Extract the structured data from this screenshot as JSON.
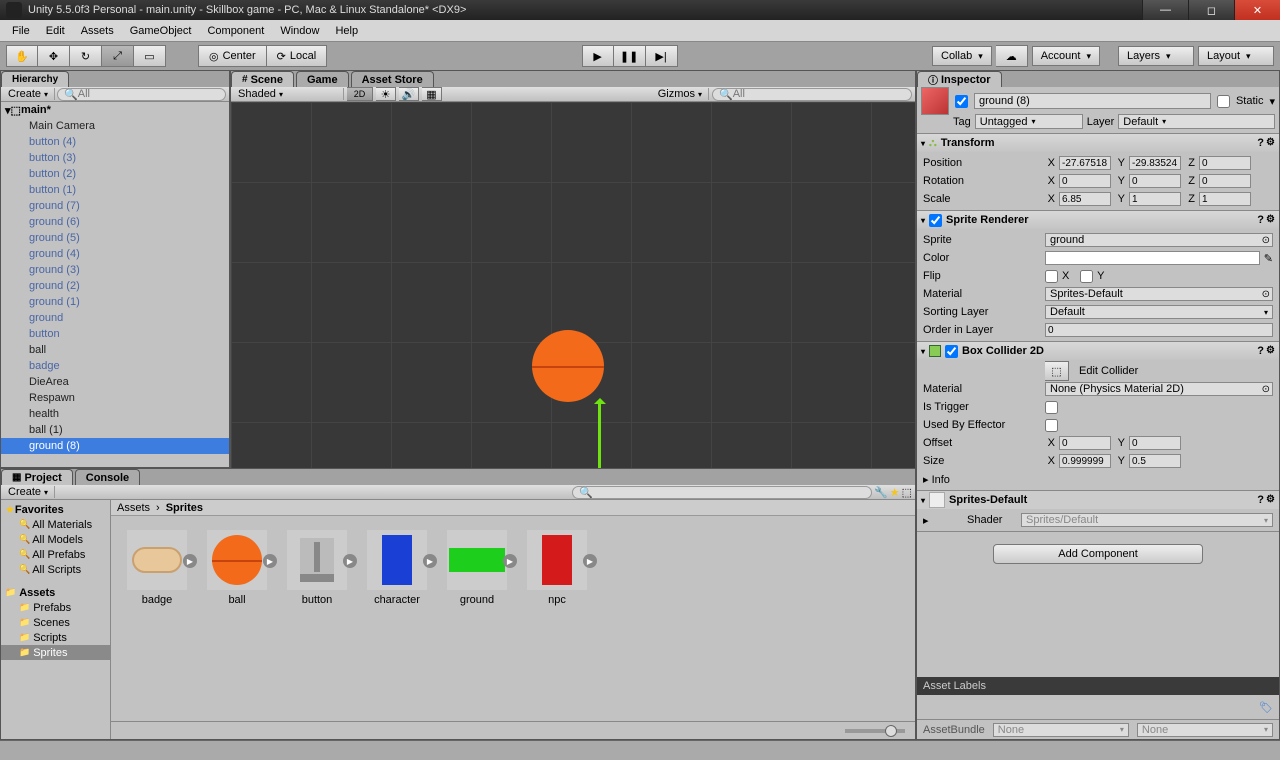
{
  "window": {
    "title": "Unity 5.5.0f3 Personal - main.unity - Skillbox game - PC, Mac & Linux Standalone* <DX9>"
  },
  "menu": [
    "File",
    "Edit",
    "Assets",
    "GameObject",
    "Component",
    "Window",
    "Help"
  ],
  "toolbar": {
    "center": "Center",
    "local": "Local",
    "collab": "Collab",
    "account": "Account",
    "layers": "Layers",
    "layout": "Layout"
  },
  "hierarchy": {
    "tab": "Hierarchy",
    "create": "Create",
    "search_placeholder": "All",
    "scene": "main*",
    "items": [
      {
        "n": "Main Camera",
        "p": false
      },
      {
        "n": "button (4)",
        "p": true
      },
      {
        "n": "button (3)",
        "p": true
      },
      {
        "n": "button (2)",
        "p": true
      },
      {
        "n": "button (1)",
        "p": true
      },
      {
        "n": "ground (7)",
        "p": true
      },
      {
        "n": "ground (6)",
        "p": true
      },
      {
        "n": "ground (5)",
        "p": true
      },
      {
        "n": "ground (4)",
        "p": true
      },
      {
        "n": "ground (3)",
        "p": true
      },
      {
        "n": "ground (2)",
        "p": true
      },
      {
        "n": "ground (1)",
        "p": true
      },
      {
        "n": "ground",
        "p": true
      },
      {
        "n": "button",
        "p": true
      },
      {
        "n": "ball",
        "p": false
      },
      {
        "n": "badge",
        "p": true
      },
      {
        "n": "DieArea",
        "p": false
      },
      {
        "n": "Respawn",
        "p": false
      },
      {
        "n": "health",
        "p": false
      },
      {
        "n": "ball (1)",
        "p": false
      },
      {
        "n": "ground (8)",
        "p": true,
        "sel": true
      }
    ]
  },
  "scene": {
    "tabs": [
      "Scene",
      "Game",
      "Asset Store"
    ],
    "shading": "Shaded",
    "mode2d": "2D",
    "gizmos": "Gizmos",
    "search_placeholder": "All"
  },
  "project": {
    "tab": "Project",
    "console_tab": "Console",
    "create": "Create",
    "favorites": "Favorites",
    "fav_items": [
      "All Materials",
      "All Models",
      "All Prefabs",
      "All Scripts"
    ],
    "assets_root": "Assets",
    "folders": [
      "Prefabs",
      "Scenes",
      "Scripts",
      "Sprites"
    ],
    "selected_folder": "Sprites",
    "breadcrumb": [
      "Assets",
      "Sprites"
    ],
    "assets": [
      "badge",
      "ball",
      "button",
      "character",
      "ground",
      "npc"
    ]
  },
  "inspector": {
    "tab": "Inspector",
    "object_name": "ground (8)",
    "static": "Static",
    "tag_label": "Tag",
    "tag_value": "Untagged",
    "layer_label": "Layer",
    "layer_value": "Default",
    "transform": {
      "title": "Transform",
      "rows": {
        "position": {
          "l": "Position",
          "x": "-27.67518",
          "y": "-29.83524",
          "z": "0"
        },
        "rotation": {
          "l": "Rotation",
          "x": "0",
          "y": "0",
          "z": "0"
        },
        "scale": {
          "l": "Scale",
          "x": "6.85",
          "y": "1",
          "z": "1"
        }
      }
    },
    "sprite_renderer": {
      "title": "Sprite Renderer",
      "sprite_l": "Sprite",
      "sprite_v": "ground",
      "color_l": "Color",
      "flip_l": "Flip",
      "flip_x": "X",
      "flip_y": "Y",
      "material_l": "Material",
      "material_v": "Sprites-Default",
      "sorting_layer_l": "Sorting Layer",
      "sorting_layer_v": "Default",
      "order_l": "Order in Layer",
      "order_v": "0"
    },
    "box_collider": {
      "title": "Box Collider 2D",
      "edit_btn": "Edit Collider",
      "material_l": "Material",
      "material_v": "None (Physics Material 2D)",
      "trigger_l": "Is Trigger",
      "effector_l": "Used By Effector",
      "offset_l": "Offset",
      "offset_x": "0",
      "offset_y": "0",
      "size_l": "Size",
      "size_x": "0.999999",
      "size_y": "0.5",
      "info_l": "Info"
    },
    "material": {
      "name": "Sprites-Default",
      "shader_l": "Shader",
      "shader_v": "Sprites/Default"
    },
    "add_component": "Add Component",
    "asset_labels": "Asset Labels",
    "asset_bundle": "AssetBundle",
    "none": "None"
  }
}
